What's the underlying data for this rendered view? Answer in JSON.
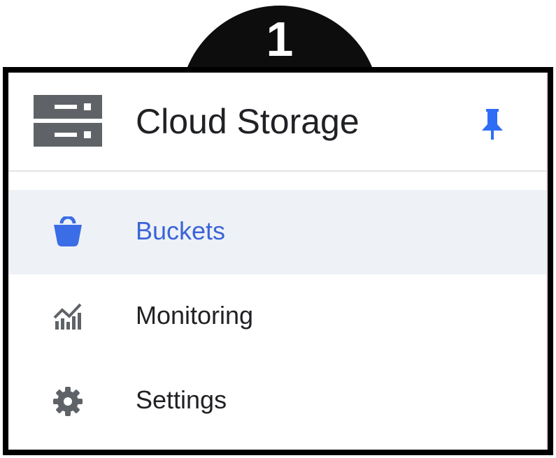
{
  "step": {
    "number": "1"
  },
  "header": {
    "title": "Cloud Storage",
    "product_icon": "storage-icon",
    "pin_icon": "pin-icon"
  },
  "nav": {
    "items": [
      {
        "label": "Buckets",
        "icon": "bucket-icon",
        "active": true
      },
      {
        "label": "Monitoring",
        "icon": "monitoring-icon",
        "active": false
      },
      {
        "label": "Settings",
        "icon": "gear-icon",
        "active": false
      }
    ]
  },
  "colors": {
    "accent": "#3c64d6",
    "active_background": "#eef2f7",
    "icon_gray": "#5f6368",
    "text": "#202124",
    "frame": "#000000"
  }
}
